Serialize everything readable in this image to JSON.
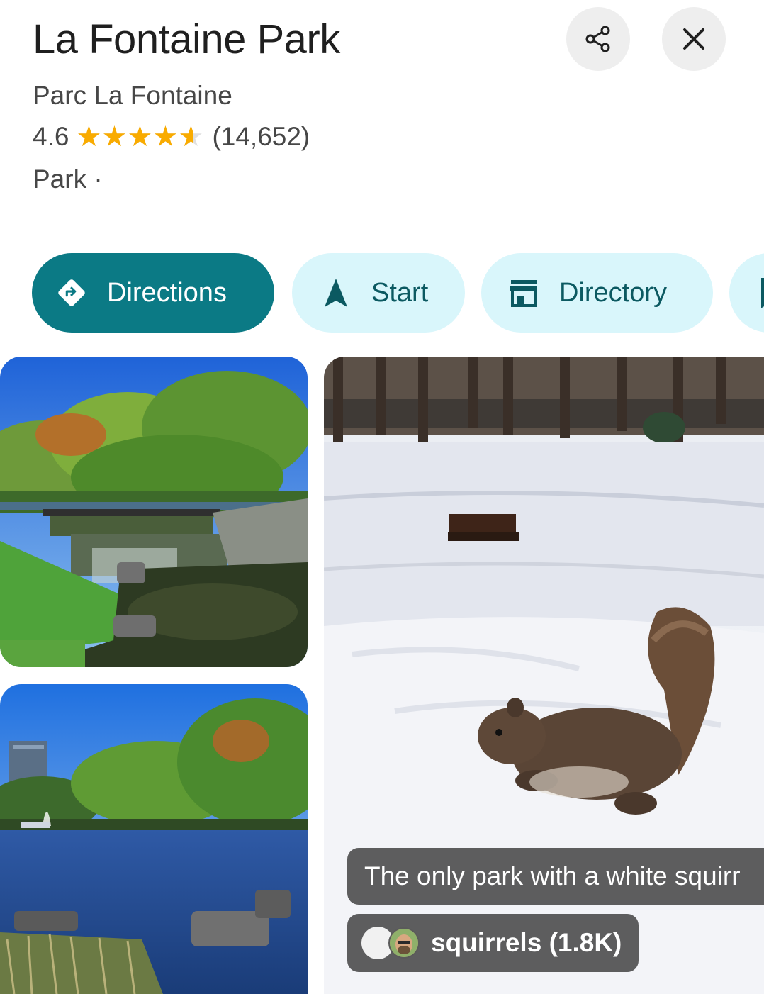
{
  "place": {
    "title": "La Fontaine Park",
    "subtitle": "Parc La Fontaine",
    "rating": "4.6",
    "rating_value": 4.6,
    "review_count": "(14,652)",
    "category": "Park ·"
  },
  "header_actions": {
    "share_icon": "share-icon",
    "close_icon": "close-icon"
  },
  "chips": {
    "directions": "Directions",
    "start": "Start",
    "directory": "Directory"
  },
  "photos": {
    "caption": "The only park with a white squirr",
    "tag_label": "squirrels (1.8K)"
  },
  "colors": {
    "primary_chip": "#0b7a85",
    "secondary_chip": "#d9f6fb",
    "star": "#f9ab00"
  }
}
